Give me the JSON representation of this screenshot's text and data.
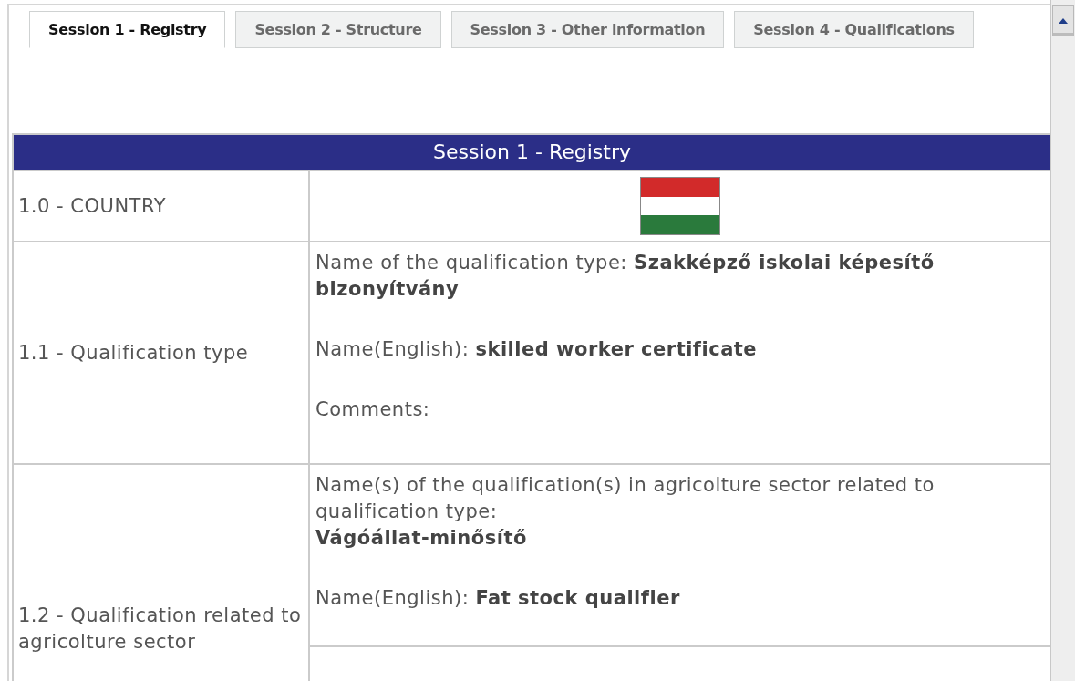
{
  "tabs": [
    {
      "label": "Session 1 - Registry",
      "selected": true
    },
    {
      "label": "Session 2 - Structure",
      "selected": false
    },
    {
      "label": "Session 3 - Other information",
      "selected": false
    },
    {
      "label": "Session 4 - Qualifications",
      "selected": false
    }
  ],
  "section": {
    "title": "Session 1 - Registry"
  },
  "rows": [
    {
      "kind": "flag",
      "label": "1.0 - COUNTRY"
    },
    {
      "kind": "fields",
      "label": "1.1 - Qualification type",
      "fields": [
        {
          "kind": "inline",
          "label": "Name of the qualification type:",
          "value": "Szakképző iskolai képesítő bizonyítvány"
        },
        {
          "kind": "inline",
          "label": "Name(English):",
          "value": "skilled worker certificate"
        },
        {
          "kind": "inline",
          "label": "Comments:"
        }
      ]
    },
    {
      "kind": "fields",
      "label": "1.2 - Qualification related to agricolture sector",
      "more": true,
      "fields": [
        {
          "kind": "stacked",
          "label": "Name(s) of the qualification(s) in agricolture sector related to qualification type:",
          "value": "Vágóállat-minősítő"
        },
        {
          "kind": "inline",
          "label": "Name(English):",
          "value": "Fat stock qualifier"
        }
      ]
    }
  ]
}
